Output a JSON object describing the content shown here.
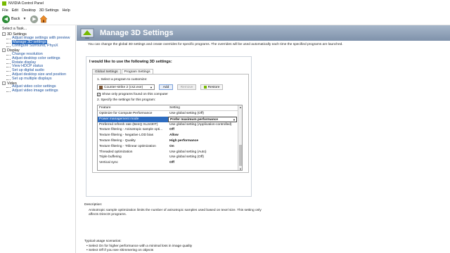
{
  "window": {
    "title": "NVIDIA Control Panel"
  },
  "menu": [
    "File",
    "Edit",
    "Desktop",
    "3D Settings",
    "Help"
  ],
  "toolbar": {
    "back_label": "Back"
  },
  "left_panel": {
    "title": "Select a Task...",
    "tree": [
      {
        "type": "cat",
        "label": "3D Settings",
        "toggle": "-"
      },
      {
        "type": "item",
        "label": "Adjust image settings with preview"
      },
      {
        "type": "item",
        "label": "Manage 3D settings",
        "selected": true
      },
      {
        "type": "item",
        "label": "Configure Surround, PhysX"
      },
      {
        "type": "cat",
        "label": "Display",
        "toggle": "-"
      },
      {
        "type": "item",
        "label": "Change resolution"
      },
      {
        "type": "item",
        "label": "Adjust desktop color settings"
      },
      {
        "type": "item",
        "label": "Rotate display"
      },
      {
        "type": "item",
        "label": "View HDCP status"
      },
      {
        "type": "item",
        "label": "Set up digital audio"
      },
      {
        "type": "item",
        "label": "Adjust desktop size and position"
      },
      {
        "type": "item",
        "label": "Set up multiple displays"
      },
      {
        "type": "cat",
        "label": "Video",
        "toggle": "-"
      },
      {
        "type": "item",
        "label": "Adjust video color settings"
      },
      {
        "type": "item",
        "label": "Adjust video image settings"
      }
    ]
  },
  "page": {
    "title": "Manage 3D Settings",
    "description": "You can change the global 3D settings and create overrides for specific programs. The overrides will be used automatically each time the specified programs are launched.",
    "heading": "I would like to use the following 3D settings:",
    "tabs": [
      "Global Settings",
      "Program Settings"
    ],
    "step1": "1. Select a program to customize:",
    "program": "Counter-strike 2 (cs2.exe)",
    "buttons": {
      "add": "Add",
      "remove": "Remove",
      "restore": "Restore"
    },
    "checkbox_label": "Show only programs found on this computer",
    "step2": "2. Specify the settings for this program:",
    "columns": {
      "feature": "Feature",
      "setting": "Setting"
    },
    "settings": [
      {
        "feature": "Optimize for Compute Performance",
        "setting": "Use global setting (Off)"
      },
      {
        "feature": "Power management mode",
        "setting": "Prefer maximum performance",
        "selected": true
      },
      {
        "feature": "Preferred refresh rate (BenQ XL2430T)",
        "setting": "Use global setting (Application-controlled)"
      },
      {
        "feature": "Texture filtering - Anisotropic sample opti...",
        "setting": "Off",
        "bold": true
      },
      {
        "feature": "Texture filtering - Negative LOD bias",
        "setting": "Allow",
        "bold": true
      },
      {
        "feature": "Texture filtering - Quality",
        "setting": "High performance",
        "bold": true
      },
      {
        "feature": "Texture filtering - Trilinear optimization",
        "setting": "On",
        "bold": true
      },
      {
        "feature": "Threaded optimization",
        "setting": "Use global setting (Auto)"
      },
      {
        "feature": "Triple buffering",
        "setting": "Use global setting (Off)"
      },
      {
        "feature": "Vertical sync",
        "setting": "Off",
        "bold": true
      }
    ],
    "description_label": "Description:",
    "description_text": "Anisotropic sample optimization limits the number of anisotropic samples used based on texel size. This setting only affects DirectX programs.",
    "usage_label": "Typical usage scenarios:",
    "usage": [
      "Select On for higher performance with a minimal loss in image quality",
      "Select Off if you see shimmering on objects"
    ]
  }
}
